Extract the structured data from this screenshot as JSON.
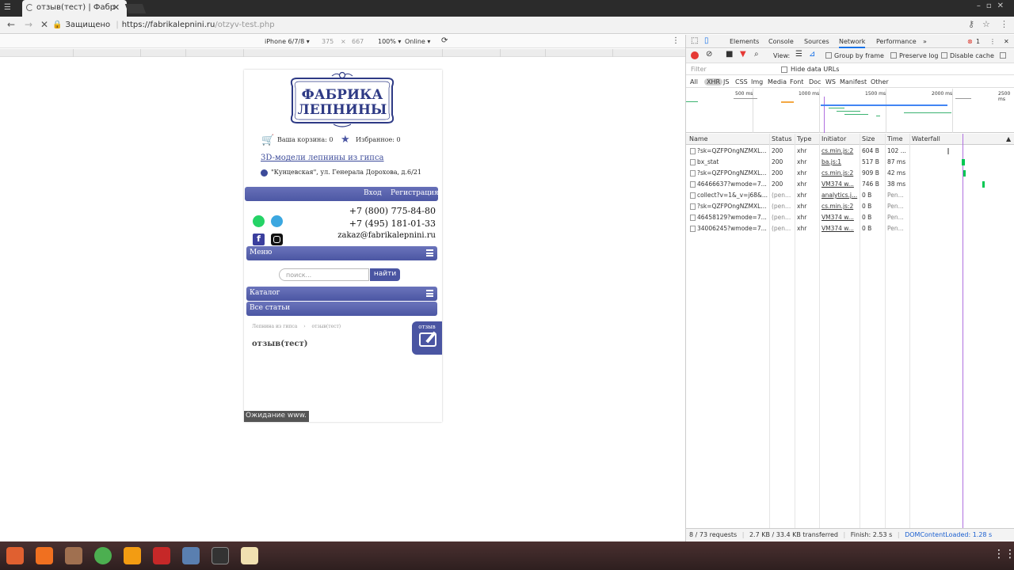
{
  "browser": {
    "tab_title": "отзыв(тест) | Фабр",
    "url_lock_label": "Защищено",
    "url_host": "https://fabrikalepnini.ru",
    "url_path": "/otzyv-test.php"
  },
  "device_toolbar": {
    "device": "iPhone 6/7/8 ▾",
    "width": "375",
    "times": "×",
    "height": "667",
    "zoom": "100% ▾",
    "network": "Online ▾"
  },
  "page": {
    "logo_line1": "ФАБРИКА",
    "logo_line2": "ЛЕПНИНЫ",
    "cart_label": "Ваша корзина: 0",
    "fav_label": "Избранное: 0",
    "link_3d": "3D-модели лепнины из гипса",
    "address": "\"Кунцевская\", ул. Генерала Дорохова, д.6/21",
    "login": "Вход",
    "register": "Регистрация",
    "phone1": "+7 (800) 775-84-80",
    "phone2": "+7 (495) 181-01-33",
    "email": "zakaz@fabrikalepnini.ru",
    "menu": "Меню",
    "search_placeholder": "поиск...",
    "find_button": "найти",
    "catalog": "Каталог",
    "all_articles": "Все статьи",
    "crumb_home": "Лепнина из гипса",
    "crumb_sep": "›",
    "crumb_current": "отзыв(тест)",
    "heading": "отзыв(тест)",
    "review_badge": "отзыв",
    "status_waiting": "Ожидание www."
  },
  "devtools": {
    "tabs": [
      "Elements",
      "Console",
      "Sources",
      "Network",
      "Performance",
      "»"
    ],
    "active_tab": "Network",
    "error_count": "1",
    "view_label": "View:",
    "group_by_frame": "Group by frame",
    "preserve_log": "Preserve log",
    "disable_cache": "Disable cache",
    "filter_placeholder": "Filter",
    "hide_data_urls": "Hide data URLs",
    "types": [
      "All",
      "XHR",
      "JS",
      "CSS",
      "Img",
      "Media",
      "Font",
      "Doc",
      "WS",
      "Manifest",
      "Other"
    ],
    "timeline_ticks": [
      "500 ms",
      "1000 ms",
      "1500 ms",
      "2000 ms",
      "2500 ms"
    ],
    "columns": [
      "Name",
      "Status",
      "Type",
      "Initiator",
      "Size",
      "Time",
      "Waterfall"
    ],
    "rows": [
      {
        "name": "?sk=QZFPOngNZMXL...",
        "status": "200",
        "type": "xhr",
        "initiator": "cs.min.js:2",
        "size": "604 B",
        "time": "102 ..."
      },
      {
        "name": "bx_stat",
        "status": "200",
        "type": "xhr",
        "initiator": "ba.js:1",
        "size": "517 B",
        "time": "87 ms"
      },
      {
        "name": "?sk=QZFPOngNZMXL...",
        "status": "200",
        "type": "xhr",
        "initiator": "cs.min.js:2",
        "size": "909 B",
        "time": "42 ms"
      },
      {
        "name": "46466637?wmode=7...",
        "status": "200",
        "type": "xhr",
        "initiator": "VM374 w...",
        "size": "746 B",
        "time": "38 ms"
      },
      {
        "name": "collect?v=1&_v=j68&...",
        "status": "(pen...",
        "type": "xhr",
        "initiator": "analytics.j...",
        "size": "0 B",
        "time": "Pen..."
      },
      {
        "name": "?sk=QZFPOngNZMXL...",
        "status": "(pen...",
        "type": "xhr",
        "initiator": "cs.min.js:2",
        "size": "0 B",
        "time": "Pen..."
      },
      {
        "name": "46458129?wmode=7...",
        "status": "(pen...",
        "type": "xhr",
        "initiator": "VM374 w...",
        "size": "0 B",
        "time": "Pen..."
      },
      {
        "name": "34006245?wmode=7...",
        "status": "(pen...",
        "type": "xhr",
        "initiator": "VM374 w...",
        "size": "0 B",
        "time": "Pen..."
      }
    ],
    "status_requests": "8 / 73 requests",
    "status_transferred": "2.7 KB / 33.4 KB transferred",
    "status_finish": "Finish: 2.53 s",
    "status_dcl": "DOMContentLoaded: 1.28 s"
  },
  "colors": {
    "brand": "#4a55a2",
    "link": "#3c4b9a"
  }
}
